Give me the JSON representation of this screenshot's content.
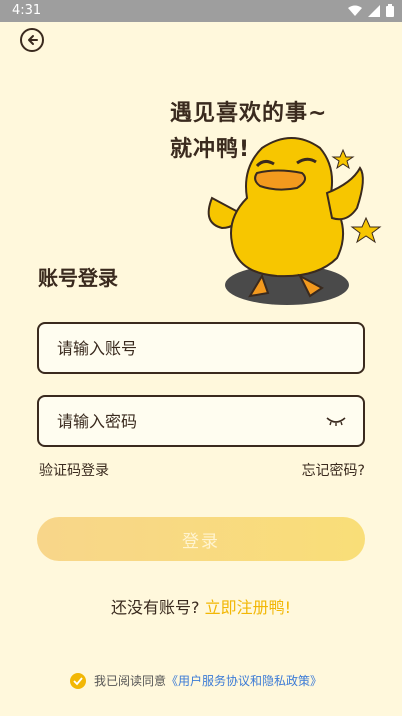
{
  "status_bar": {
    "time": "4:31"
  },
  "slogan": {
    "line1": "遇见喜欢的事~",
    "line2": "就冲鸭!"
  },
  "form": {
    "title": "账号登录",
    "account_placeholder": "请输入账号",
    "password_placeholder": "请输入密码",
    "sms_login": "验证码登录",
    "forgot_password": "忘记密码?",
    "login_button": "登录"
  },
  "register": {
    "prompt": "还没有账号?",
    "link": "立即注册鸭!"
  },
  "agreement": {
    "prefix": "我已阅读同意",
    "policy": "《用户服务协议和隐私政策》"
  },
  "colors": {
    "background": "#FFF8DC",
    "accent": "#F2B705",
    "link": "#3C7BD6",
    "text": "#3A2A1E"
  },
  "icons": [
    "back-arrow-icon",
    "wifi-icon",
    "signal-icon",
    "battery-icon",
    "eye-closed-icon",
    "check-icon"
  ]
}
